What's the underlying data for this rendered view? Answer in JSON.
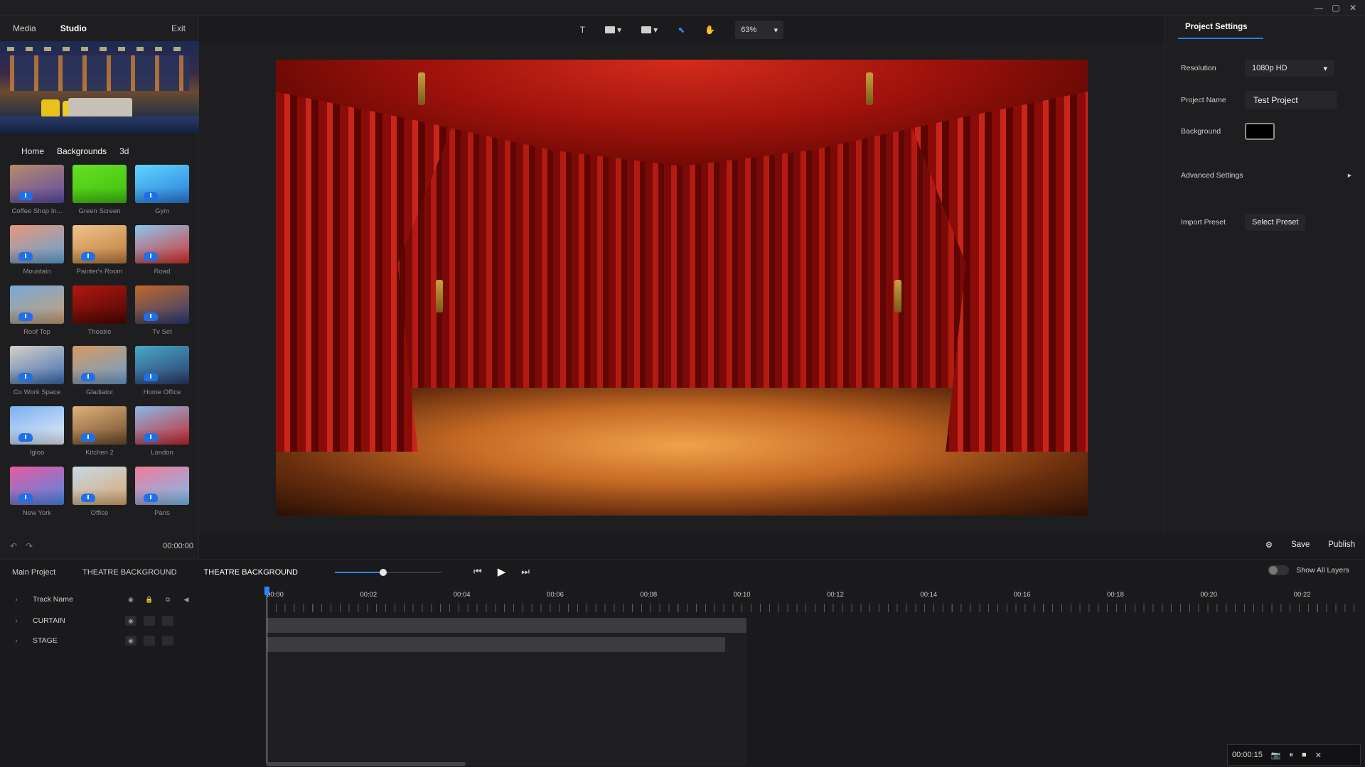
{
  "window": {
    "minimize": "—",
    "maximize": "▢",
    "close": "✕"
  },
  "nav": {
    "media": "Media",
    "studio": "Studio",
    "exit": "Exit"
  },
  "library": {
    "tabs": [
      "Home",
      "Backgrounds",
      "3d"
    ],
    "items": [
      {
        "label": "Coffee Shop In...",
        "color1": "#b98a6a",
        "color2": "#5a4aa8"
      },
      {
        "label": "Green Screen",
        "color1": "#66e022",
        "color2": "#3fbf10"
      },
      {
        "label": "Gym",
        "color1": "#5fd6ff",
        "color2": "#2a7ad8"
      },
      {
        "label": "Mountain",
        "color1": "#e8967a",
        "color2": "#5fa6d8"
      },
      {
        "label": "Painter's Room",
        "color1": "#f2c48a",
        "color2": "#b87a3c"
      },
      {
        "label": "Road",
        "color1": "#8ac8f0",
        "color2": "#d8302a"
      },
      {
        "label": "Roof Top",
        "color1": "#7aa8d8",
        "color2": "#c8a074"
      },
      {
        "label": "Theatre",
        "color1": "#b01810",
        "color2": "#4a0604"
      },
      {
        "label": "Tv Set",
        "color1": "#c06a2a",
        "color2": "#2a3a78"
      },
      {
        "label": "Co Work Space",
        "color1": "#d8d0c8",
        "color2": "#3a6ab0"
      },
      {
        "label": "Gladiator",
        "color1": "#d89a62",
        "color2": "#6aa0d0"
      },
      {
        "label": "Home Office",
        "color1": "#4aa8c8",
        "color2": "#2a3a6a"
      },
      {
        "label": "Igloo",
        "color1": "#7ab0f0",
        "color2": "#e8eef8"
      },
      {
        "label": "Kitchen 2",
        "color1": "#e0b27a",
        "color2": "#6a4a2a"
      },
      {
        "label": "London",
        "color1": "#8ab8e8",
        "color2": "#c8282a"
      },
      {
        "label": "New York",
        "color1": "#e85aa0",
        "color2": "#4a8ae8"
      },
      {
        "label": "Office",
        "color1": "#c8d8e8",
        "color2": "#d8a870"
      },
      {
        "label": "Paris",
        "color1": "#f07a9a",
        "color2": "#7ac0f0"
      }
    ]
  },
  "undo_bar": {
    "undo": "↶",
    "redo": "↷",
    "time": "00:00:00"
  },
  "toolbar": {
    "text_tool": "T",
    "shape_caret": "▾",
    "layout_caret": "▾",
    "select_tool": "⬉",
    "hand_tool": "✋",
    "zoom": "63%",
    "zoom_caret": "▾"
  },
  "settings": {
    "tab": "Project Settings",
    "resolution_label": "Resolution",
    "resolution_value": "1080p HD",
    "project_name_label": "Project Name",
    "project_name_value": "Test Project",
    "background_label": "Background",
    "background_color": "#000000",
    "advanced_label": "Advanced Settings",
    "advanced_arrow": "▸",
    "import_label": "Import Preset",
    "select_preset": "Select Preset"
  },
  "actions": {
    "gear": "⚙",
    "save": "Save",
    "publish": "Publish"
  },
  "timeline": {
    "tabs": [
      "Main Project",
      "THEATRE BACKGROUND",
      "THEATRE BACKGROUND"
    ],
    "zoom_slider_value": 0.45,
    "transport": {
      "prev": "⏮",
      "play": "▶",
      "next": "⏭"
    },
    "show_all_layers": "Show All Layers",
    "header": {
      "track_name": "Track Name",
      "eye": "◉",
      "lock": "🔒",
      "group": "⧉",
      "audio": "◀"
    },
    "tracks": [
      {
        "name": "CURTAIN",
        "eye": "◉"
      },
      {
        "name": "STAGE",
        "eye": "◉"
      }
    ],
    "ticks": [
      "00:00",
      "00:02",
      "00:04",
      "00:06",
      "00:08",
      "00:10",
      "00:12",
      "00:14",
      "00:16",
      "00:18",
      "00:20",
      "00:22"
    ]
  },
  "recorder": {
    "time": "00:00:15",
    "camera": "📷",
    "pause": "⏸",
    "stop": "■",
    "close": "✕"
  }
}
